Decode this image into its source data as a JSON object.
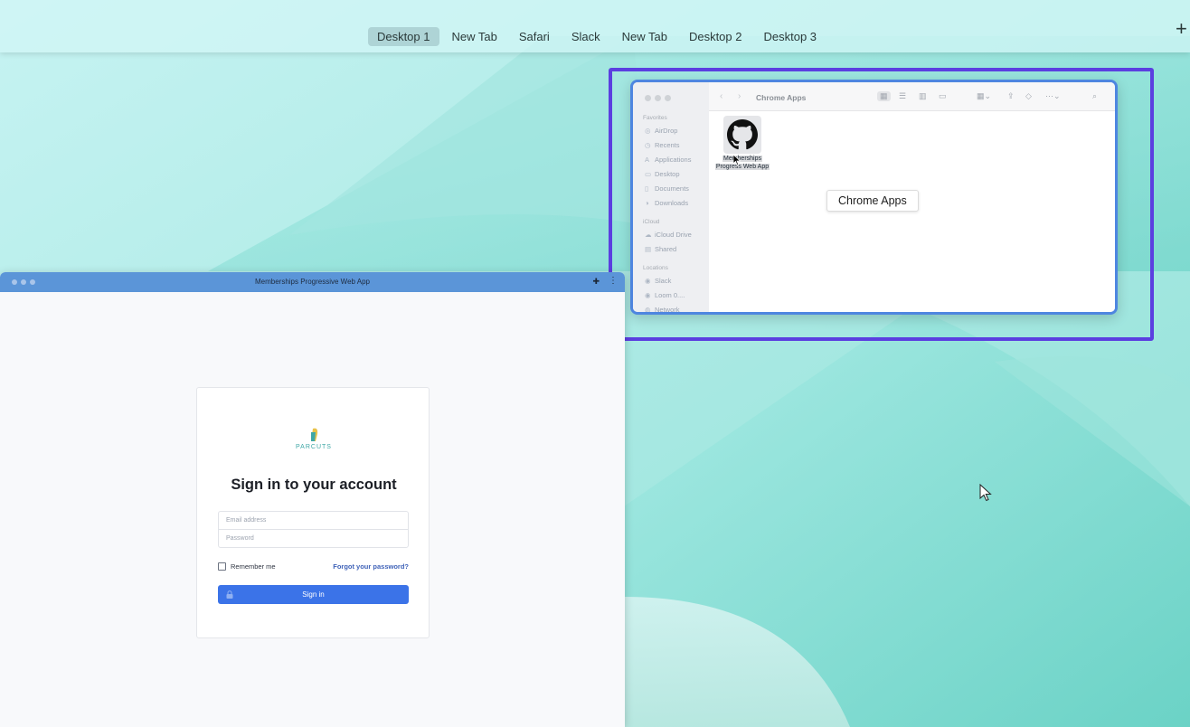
{
  "spaces_bar": {
    "tabs": [
      "Desktop 1",
      "New Tab",
      "Safari",
      "Slack",
      "New Tab",
      "Desktop 2",
      "Desktop 3"
    ],
    "active_index": 0,
    "add_symbol": "+"
  },
  "finder": {
    "title": "Chrome Apps",
    "sidebar": {
      "favorites_header": "Favorites",
      "favorites": [
        "AirDrop",
        "Recents",
        "Applications",
        "Desktop",
        "Documents",
        "Downloads"
      ],
      "icloud_header": "iCloud",
      "icloud": [
        "iCloud Drive",
        "Shared"
      ],
      "locations_header": "Locations",
      "locations": [
        "Slack",
        "Loom 0....",
        "Network"
      ]
    },
    "item": {
      "label_line1": "Memberships",
      "label_line2": "Progress Web App"
    },
    "tooltip": "Chrome Apps"
  },
  "pwa": {
    "title": "Memberships Progressive Web App",
    "logo_text": "PARCUTS",
    "heading": "Sign in to your account",
    "email_placeholder": "Email address",
    "password_placeholder": "Password",
    "remember_label": "Remember me",
    "forgot_label": "Forgot your password?",
    "signin_label": "Sign in"
  },
  "colors": {
    "selection_frame": "#5b3fe0",
    "pwa_titlebar": "#5b95d8",
    "signin_button": "#3b73e8",
    "link": "#3f62b8"
  }
}
